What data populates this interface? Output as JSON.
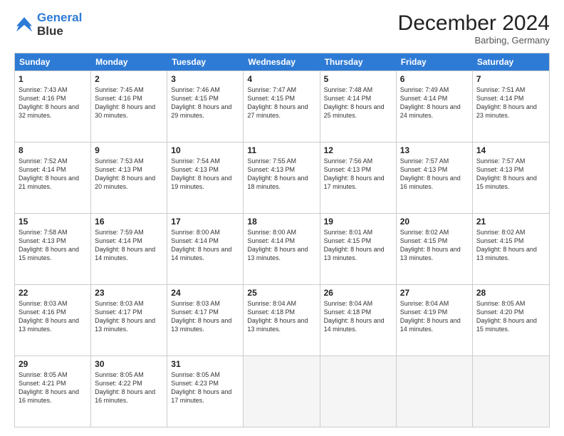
{
  "header": {
    "logo_line1": "General",
    "logo_line2": "Blue",
    "month": "December 2024",
    "location": "Barbing, Germany"
  },
  "days_of_week": [
    "Sunday",
    "Monday",
    "Tuesday",
    "Wednesday",
    "Thursday",
    "Friday",
    "Saturday"
  ],
  "weeks": [
    [
      {
        "day": 1,
        "sunrise": "7:43 AM",
        "sunset": "4:16 PM",
        "daylight": "8 hours and 32 minutes."
      },
      {
        "day": 2,
        "sunrise": "7:45 AM",
        "sunset": "4:16 PM",
        "daylight": "8 hours and 30 minutes."
      },
      {
        "day": 3,
        "sunrise": "7:46 AM",
        "sunset": "4:15 PM",
        "daylight": "8 hours and 29 minutes."
      },
      {
        "day": 4,
        "sunrise": "7:47 AM",
        "sunset": "4:15 PM",
        "daylight": "8 hours and 27 minutes."
      },
      {
        "day": 5,
        "sunrise": "7:48 AM",
        "sunset": "4:14 PM",
        "daylight": "8 hours and 25 minutes."
      },
      {
        "day": 6,
        "sunrise": "7:49 AM",
        "sunset": "4:14 PM",
        "daylight": "8 hours and 24 minutes."
      },
      {
        "day": 7,
        "sunrise": "7:51 AM",
        "sunset": "4:14 PM",
        "daylight": "8 hours and 23 minutes."
      }
    ],
    [
      {
        "day": 8,
        "sunrise": "7:52 AM",
        "sunset": "4:14 PM",
        "daylight": "8 hours and 21 minutes."
      },
      {
        "day": 9,
        "sunrise": "7:53 AM",
        "sunset": "4:13 PM",
        "daylight": "8 hours and 20 minutes."
      },
      {
        "day": 10,
        "sunrise": "7:54 AM",
        "sunset": "4:13 PM",
        "daylight": "8 hours and 19 minutes."
      },
      {
        "day": 11,
        "sunrise": "7:55 AM",
        "sunset": "4:13 PM",
        "daylight": "8 hours and 18 minutes."
      },
      {
        "day": 12,
        "sunrise": "7:56 AM",
        "sunset": "4:13 PM",
        "daylight": "8 hours and 17 minutes."
      },
      {
        "day": 13,
        "sunrise": "7:57 AM",
        "sunset": "4:13 PM",
        "daylight": "8 hours and 16 minutes."
      },
      {
        "day": 14,
        "sunrise": "7:57 AM",
        "sunset": "4:13 PM",
        "daylight": "8 hours and 15 minutes."
      }
    ],
    [
      {
        "day": 15,
        "sunrise": "7:58 AM",
        "sunset": "4:13 PM",
        "daylight": "8 hours and 15 minutes."
      },
      {
        "day": 16,
        "sunrise": "7:59 AM",
        "sunset": "4:14 PM",
        "daylight": "8 hours and 14 minutes."
      },
      {
        "day": 17,
        "sunrise": "8:00 AM",
        "sunset": "4:14 PM",
        "daylight": "8 hours and 14 minutes."
      },
      {
        "day": 18,
        "sunrise": "8:00 AM",
        "sunset": "4:14 PM",
        "daylight": "8 hours and 13 minutes."
      },
      {
        "day": 19,
        "sunrise": "8:01 AM",
        "sunset": "4:15 PM",
        "daylight": "8 hours and 13 minutes."
      },
      {
        "day": 20,
        "sunrise": "8:02 AM",
        "sunset": "4:15 PM",
        "daylight": "8 hours and 13 minutes."
      },
      {
        "day": 21,
        "sunrise": "8:02 AM",
        "sunset": "4:15 PM",
        "daylight": "8 hours and 13 minutes."
      }
    ],
    [
      {
        "day": 22,
        "sunrise": "8:03 AM",
        "sunset": "4:16 PM",
        "daylight": "8 hours and 13 minutes."
      },
      {
        "day": 23,
        "sunrise": "8:03 AM",
        "sunset": "4:17 PM",
        "daylight": "8 hours and 13 minutes."
      },
      {
        "day": 24,
        "sunrise": "8:03 AM",
        "sunset": "4:17 PM",
        "daylight": "8 hours and 13 minutes."
      },
      {
        "day": 25,
        "sunrise": "8:04 AM",
        "sunset": "4:18 PM",
        "daylight": "8 hours and 13 minutes."
      },
      {
        "day": 26,
        "sunrise": "8:04 AM",
        "sunset": "4:18 PM",
        "daylight": "8 hours and 14 minutes."
      },
      {
        "day": 27,
        "sunrise": "8:04 AM",
        "sunset": "4:19 PM",
        "daylight": "8 hours and 14 minutes."
      },
      {
        "day": 28,
        "sunrise": "8:05 AM",
        "sunset": "4:20 PM",
        "daylight": "8 hours and 15 minutes."
      }
    ],
    [
      {
        "day": 29,
        "sunrise": "8:05 AM",
        "sunset": "4:21 PM",
        "daylight": "8 hours and 16 minutes."
      },
      {
        "day": 30,
        "sunrise": "8:05 AM",
        "sunset": "4:22 PM",
        "daylight": "8 hours and 16 minutes."
      },
      {
        "day": 31,
        "sunrise": "8:05 AM",
        "sunset": "4:23 PM",
        "daylight": "8 hours and 17 minutes."
      },
      null,
      null,
      null,
      null
    ]
  ]
}
